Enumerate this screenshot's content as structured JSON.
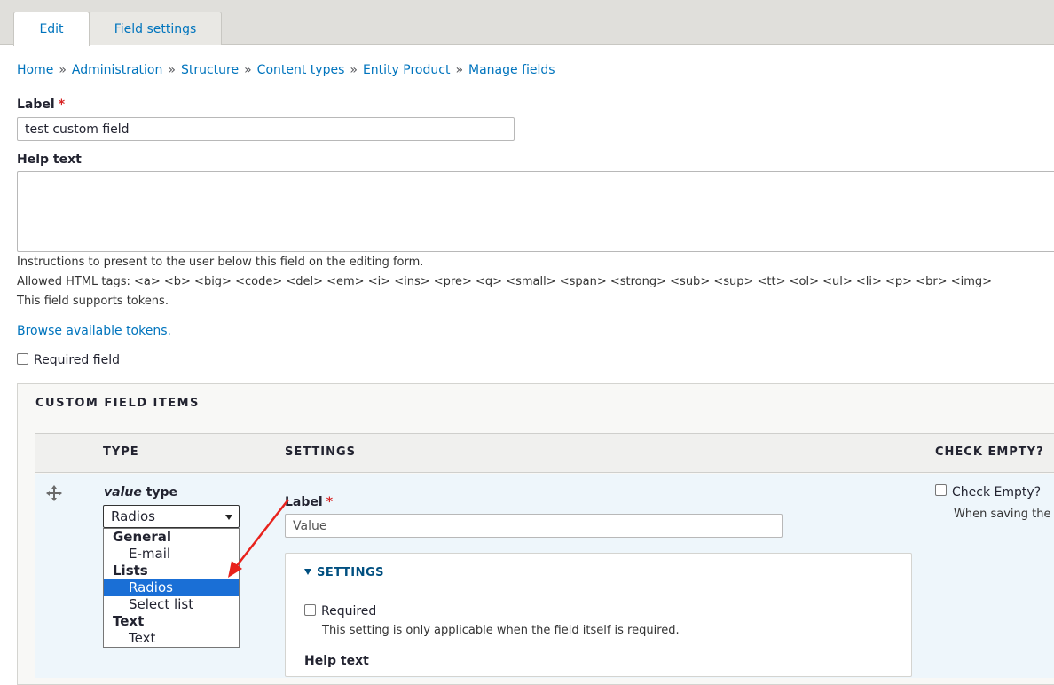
{
  "tabs": [
    {
      "label": "Edit",
      "active": true
    },
    {
      "label": "Field settings",
      "active": false
    }
  ],
  "breadcrumb": [
    "Home",
    "Administration",
    "Structure",
    "Content types",
    "Entity Product",
    "Manage fields"
  ],
  "breadcrumb_separator": "»",
  "label_field": {
    "label": "Label",
    "required_mark": "*",
    "value": "test custom field"
  },
  "help_text": {
    "label": "Help text",
    "value": "",
    "description_1": "Instructions to present to the user below this field on the editing form.",
    "description_2": "Allowed HTML tags: <a> <b> <big> <code> <del> <em> <i> <ins> <pre> <q> <small> <span> <strong> <sub> <sup> <tt> <ol> <ul> <li> <p> <br> <img>",
    "description_3": "This field supports tokens."
  },
  "browse_tokens_link": "Browse available tokens.",
  "required_field": {
    "label": "Required field",
    "checked": false
  },
  "custom_items": {
    "legend": "CUSTOM FIELD ITEMS",
    "columns": [
      "TYPE",
      "SETTINGS",
      "CHECK EMPTY?"
    ],
    "row": {
      "type_label_em": "value",
      "type_label_rest": " type",
      "selected_type": "Radios",
      "dropdown": [
        {
          "group": "General",
          "options": [
            "E-mail"
          ]
        },
        {
          "group": "Lists",
          "options": [
            "Radios",
            "Select list"
          ]
        },
        {
          "group": "Text",
          "options": [
            "Text"
          ]
        }
      ],
      "settings_label": "Label",
      "settings_required_mark": "*",
      "settings_label_value": "Value",
      "settings_summary": "SETTINGS",
      "required_checkbox_label": "Required",
      "required_description": "This setting is only applicable when the field itself is required.",
      "help_text_label": "Help text",
      "check_empty_label": "Check Empty?",
      "check_empty_description": "When saving the"
    }
  },
  "colors": {
    "link": "#0074bd",
    "required": "#d72222",
    "highlight": "#1a6fd6",
    "annotation_arrow": "#e8221c"
  },
  "icons": {
    "drag": "move-cross-icon",
    "disclosure": "triangle-down-icon",
    "select_caret": "caret-down-icon"
  }
}
